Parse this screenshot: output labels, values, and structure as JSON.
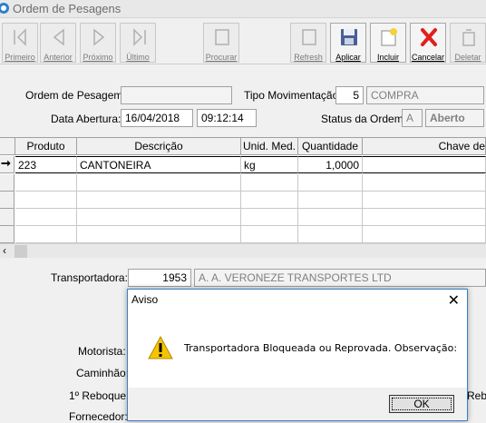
{
  "window": {
    "title": "Ordem de Pesagens"
  },
  "toolbar": {
    "primeiro": "Primeiro",
    "anterior": "Anterior",
    "proximo": "Próximo",
    "ultimo": "Último",
    "procurar": "Procurar",
    "refresh": "Refresh",
    "aplicar": "Aplicar",
    "incluir": "Incluir",
    "cancelar": "Cancelar",
    "deletar": "Deletar"
  },
  "header": {
    "ordem_label": "Ordem de Pesagem:",
    "ordem_value": "",
    "tipo_label": "Tipo Movimentação:",
    "tipo_code": "5",
    "tipo_desc": "COMPRA",
    "data_label": "Data Abertura:",
    "data_value": "16/04/2018",
    "hora_value": "09:12:14",
    "status_label": "Status da Ordem:",
    "status_code": "A",
    "status_desc": "Aberto"
  },
  "grid": {
    "columns": [
      "Produto",
      "Descrição",
      "Unid. Med.",
      "Quantidade",
      "Chave de"
    ],
    "rows": [
      {
        "produto": "223",
        "descricao": "CANTONEIRA",
        "unid": "kg",
        "quantidade": "1,0000",
        "chave": ""
      }
    ],
    "current_indicator": "➞"
  },
  "form": {
    "transportadora_label": "Transportadora:",
    "transportadora_code": "1953",
    "transportadora_name": "A. A. VERONEZE TRANSPORTES LTD",
    "motorista_label": "Motorista:",
    "caminhao_label": "Caminhão:",
    "reboque1_label": "1º Reboque:",
    "reboque_right_label": "Rebo",
    "fornecedor_label": "Fornecedor:"
  },
  "dialog": {
    "title": "Aviso",
    "close": "✕",
    "message": "Transportadora Bloqueada ou Reprovada. Observação:",
    "ok_label": "OK"
  },
  "colors": {
    "dialog_border": "#3b7fc4",
    "warning_yellow": "#f5c400",
    "cancel_red": "#e0201c"
  }
}
